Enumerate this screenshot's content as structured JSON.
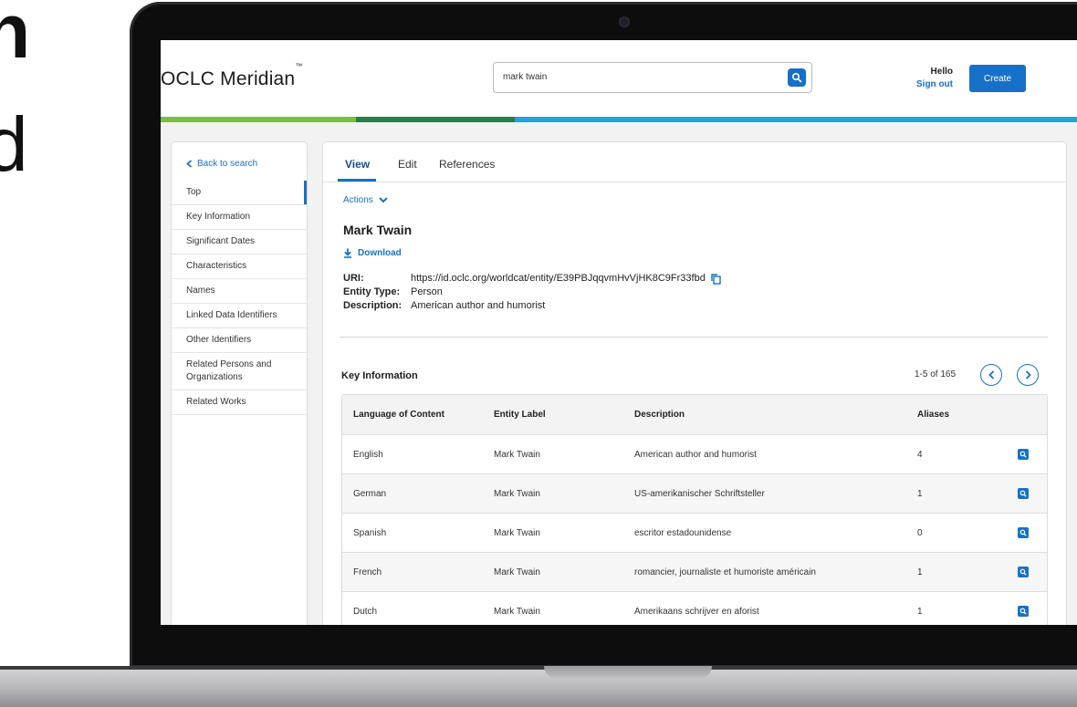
{
  "background_text": {
    "line1": "n",
    "line2": "d"
  },
  "app": {
    "logo": "OCLC Meridian",
    "logo_mark": "™"
  },
  "search": {
    "value": "mark twain"
  },
  "user": {
    "greeting": "Hello",
    "sign_out": "Sign out"
  },
  "header": {
    "create_label": "Create"
  },
  "colors": {
    "accent": "#1770c7",
    "band_green_light": "#7bbf3a",
    "band_green_dark": "#2f7a4d",
    "band_blue": "#21a5d6"
  },
  "sidebar": {
    "back_label": "Back to search",
    "items": [
      {
        "label": "Top",
        "active": true
      },
      {
        "label": "Key Information"
      },
      {
        "label": "Significant Dates"
      },
      {
        "label": "Characteristics"
      },
      {
        "label": "Names"
      },
      {
        "label": "Linked Data Identifiers"
      },
      {
        "label": "Other Identifiers"
      },
      {
        "label": "Related Persons and Organizations"
      },
      {
        "label": "Related Works"
      }
    ]
  },
  "tabs": [
    {
      "label": "View",
      "active": true
    },
    {
      "label": "Edit"
    },
    {
      "label": "References"
    }
  ],
  "entity": {
    "actions_label": "Actions",
    "title": "Mark Twain",
    "download_label": "Download",
    "uri_key": "URI:",
    "uri_value": "https://id.oclc.org/worldcat/entity/E39PBJqqvmHvVjHK8C9Fr33fbd",
    "type_key": "Entity Type:",
    "type_value": "Person",
    "desc_key": "Description:",
    "desc_value": "American author and humorist"
  },
  "key_info": {
    "title": "Key Information",
    "pager": "1-5 of 165",
    "columns": [
      "Language of Content",
      "Entity Label",
      "Description",
      "Aliases"
    ],
    "rows": [
      {
        "language": "English",
        "label": "Mark Twain",
        "description": "American author and humorist",
        "aliases": "4"
      },
      {
        "language": "German",
        "label": "Mark Twain",
        "description": "US-amerikanischer Schriftsteller",
        "aliases": "1"
      },
      {
        "language": "Spanish",
        "label": "Mark Twain",
        "description": "escritor estadounidense",
        "aliases": "0"
      },
      {
        "language": "French",
        "label": "Mark Twain",
        "description": "romancier, journaliste et humoriste américain",
        "aliases": "1"
      },
      {
        "language": "Dutch",
        "label": "Mark Twain",
        "description": "Amerikaans schrijver en aforist",
        "aliases": "1"
      }
    ]
  }
}
